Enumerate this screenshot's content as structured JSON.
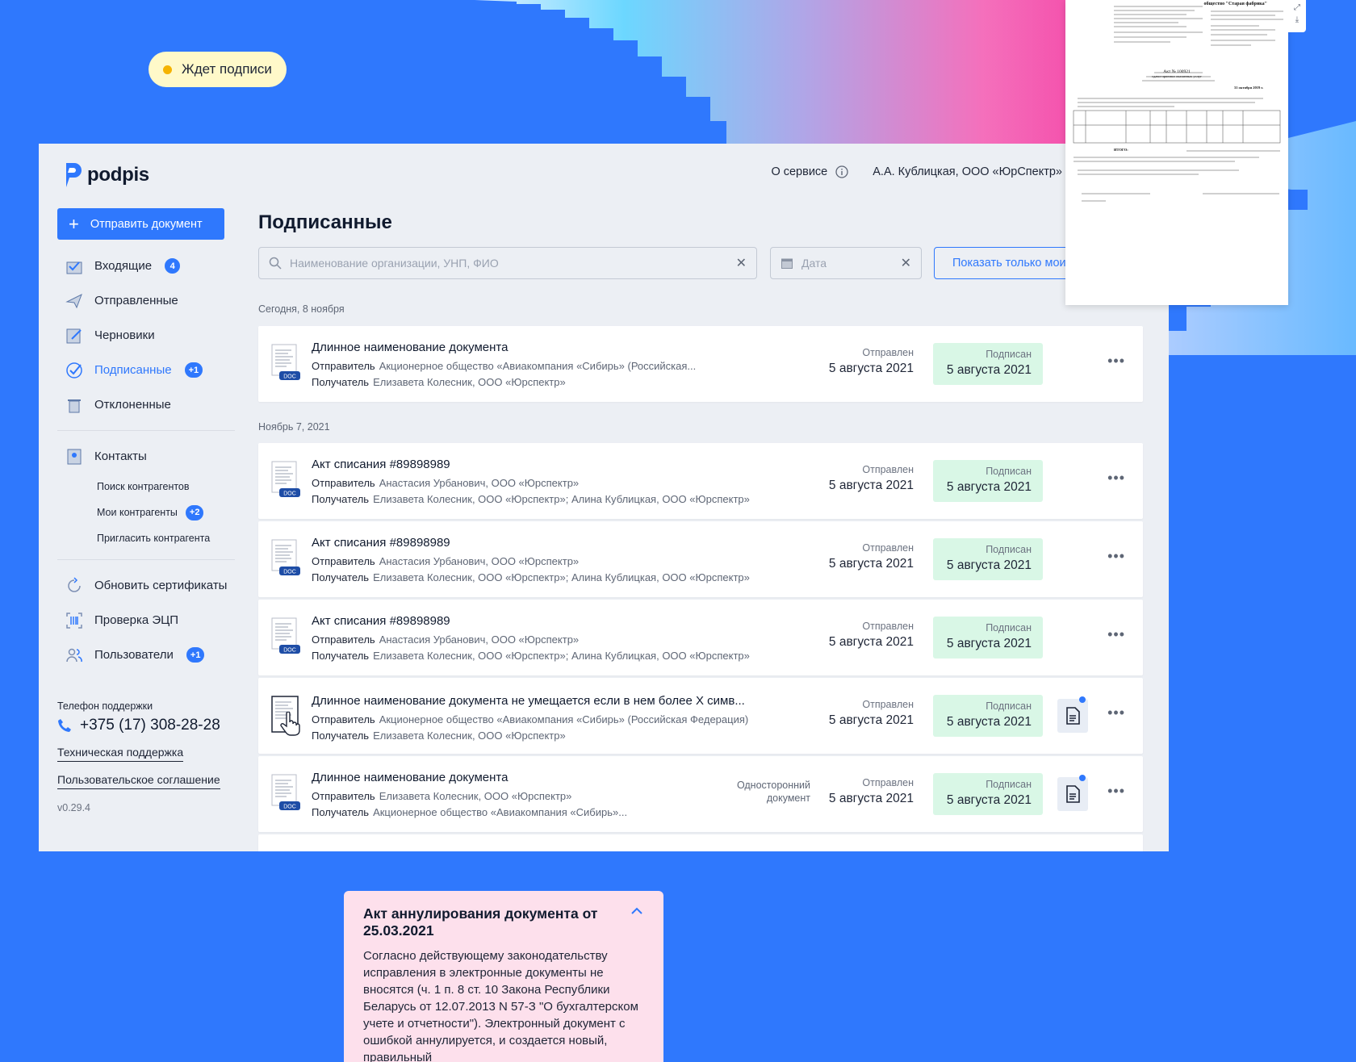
{
  "status_pill": {
    "label": "Ждет подписи"
  },
  "app": {
    "logo_text": "podpis",
    "send_button": "Отправить документ",
    "nav": [
      {
        "label": "Входящие",
        "badge": "4",
        "icon": "inbox-icon"
      },
      {
        "label": "Отправленные",
        "badge": "",
        "icon": "paper-plane-icon"
      },
      {
        "label": "Черновики",
        "badge": "",
        "icon": "pencil-icon"
      },
      {
        "label": "Подписанные",
        "badge": "+1",
        "icon": "check-circle-icon",
        "active": true
      },
      {
        "label": "Отклоненные",
        "badge": "",
        "icon": "trash-icon"
      }
    ],
    "contacts": {
      "label": "Контакты",
      "sub": [
        {
          "label": "Поиск контрагентов",
          "badge": ""
        },
        {
          "label": "Мои контрагенты",
          "badge": "+2"
        },
        {
          "label": "Пригласить контрагента",
          "badge": ""
        }
      ]
    },
    "tools": [
      {
        "label": "Обновить сертификаты",
        "badge": ""
      },
      {
        "label": "Проверка ЭЦП",
        "badge": ""
      },
      {
        "label": "Пользователи",
        "badge": "+1"
      }
    ],
    "support": {
      "label": "Телефон поддержки",
      "phone": "+375 (17) 308-28-28",
      "tech": "Техническая поддержка",
      "agreement": "Пользовательское соглашение",
      "version": "v0.29.4"
    },
    "topbar": {
      "about": "О сервисе",
      "user": "А.А. Кублицкая, ООО «ЮрСпектр»"
    },
    "page_title": "Подписанные",
    "search_placeholder": "Наименование организации, УНП, ФИО",
    "date_placeholder": "Дата",
    "mine_button": "Показать только мои",
    "labels": {
      "sender": "Отправитель",
      "recipient": "Получатель",
      "sent": "Отправлен",
      "signed": "Подписан",
      "doc": "DOC"
    },
    "groups": [
      {
        "label": "Сегодня, 8 ноября"
      },
      {
        "label": "Ноябрь 7, 2021"
      }
    ],
    "documents": [
      {
        "title": "Длинное наименование документа",
        "sender": "Акционерное общество «Авиакомпания «Сибирь» (Российская...",
        "recipient": "Елизавета Колесник, ООО «Юрспектр»",
        "sent_date": "5 августа 2021",
        "signed_date": "5 августа 2021",
        "note": ""
      },
      {
        "title": "Акт списания #89898989",
        "sender": "Анастасия Урбанович, ООО «Юрспектр»",
        "recipient": "Елизавета Колесник, ООО «Юрспектр»; Алина Кублицкая, ООО «Юрспектр»",
        "sent_date": "5 августа 2021",
        "signed_date": "5 августа 2021",
        "note": ""
      },
      {
        "title": "Акт списания #89898989",
        "sender": "Анастасия Урбанович, ООО «Юрспектр»",
        "recipient": "Елизавета Колесник, ООО «Юрспектр»; Алина Кублицкая, ООО «Юрспектр»",
        "sent_date": "5 августа 2021",
        "signed_date": "5 августа 2021",
        "note": ""
      },
      {
        "title": "Акт списания #89898989",
        "sender": "Анастасия Урбанович, ООО «Юрспектр»",
        "recipient": "Елизавета Колесник, ООО «Юрспектр»; Алина Кублицкая, ООО «Юрспектр»",
        "sent_date": "5 августа 2021",
        "signed_date": "5 августа 2021",
        "note": ""
      },
      {
        "title": "Длинное наименование документа не умещается если в нем более Х симв...",
        "sender": "Акционерное общество «Авиакомпания «Сибирь» (Российская Федерация)",
        "recipient": "Елизавета Колесник, ООО «Юрспектр»",
        "sent_date": "5 августа 2021",
        "signed_date": "5 августа 2021",
        "note": ""
      },
      {
        "title": "Длинное наименование документа",
        "sender": "Елизавета Колесник, ООО «Юрспектр»",
        "recipient": "Акционерное общество «Авиакомпания «Сибирь»...",
        "sent_date": "5 августа 2021",
        "signed_date": "5 августа 2021",
        "note": "Односторонний документ"
      }
    ]
  },
  "preview": {
    "header_right": "общество \"Старая фабрика\"",
    "act_title": "Акт № 100921",
    "act_sub": "сдачи-приемки оказанных услуг",
    "date": "31 октября 2019 г.",
    "total": "ИТОГО:"
  },
  "card": {
    "title": "Акт аннулирования документа от 25.03.2021",
    "text": "Согласно действующему законодательству исправления в электронные документы не вносятся (ч. 1 п. 8 ст. 10 Закона Республики Беларусь от 12.07.2013 N 57-З \"О бухгалтерском учете и отчетности\"). Электронный документ с ошибкой аннулируется, и создается новый, правильный"
  },
  "colors": {
    "background": "#2f78fd",
    "accent": "#2f78fd",
    "signed_bg": "#d9f7e6",
    "pill_bg": "#fff9c9",
    "card_bg": "#fde0ec"
  }
}
